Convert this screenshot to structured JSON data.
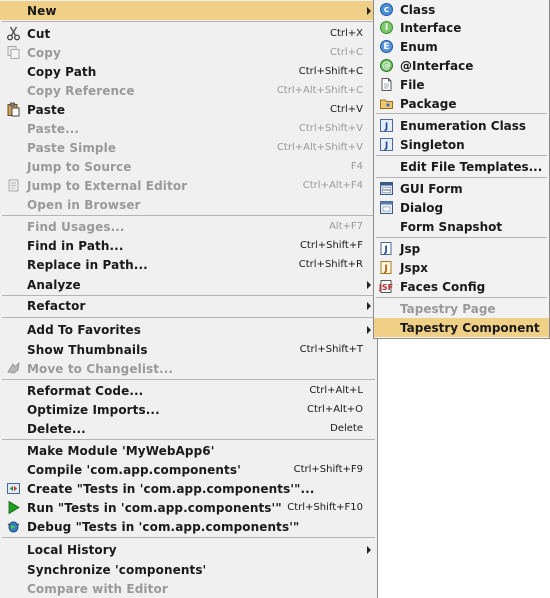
{
  "main_menu": {
    "items": [
      {
        "label": "New",
        "shortcut": "",
        "disabled": false,
        "submenu": true,
        "selected": true
      },
      {
        "label": "Cut",
        "shortcut": "Ctrl+X",
        "disabled": false,
        "icon": "scissors-icon"
      },
      {
        "label": "Copy",
        "shortcut": "Ctrl+C",
        "disabled": true,
        "icon": "copy-icon"
      },
      {
        "label": "Copy Path",
        "shortcut": "Ctrl+Shift+C",
        "disabled": false
      },
      {
        "label": "Copy Reference",
        "shortcut": "Ctrl+Alt+Shift+C",
        "disabled": true
      },
      {
        "label": "Paste",
        "shortcut": "Ctrl+V",
        "disabled": false,
        "icon": "paste-icon"
      },
      {
        "label": "Paste...",
        "shortcut": "Ctrl+Shift+V",
        "disabled": true
      },
      {
        "label": "Paste Simple",
        "shortcut": "Ctrl+Alt+Shift+V",
        "disabled": true
      },
      {
        "label": "Jump to Source",
        "shortcut": "F4",
        "disabled": true
      },
      {
        "label": "Jump to External Editor",
        "shortcut": "Ctrl+Alt+F4",
        "disabled": true,
        "icon": "external-editor-icon"
      },
      {
        "label": "Open in Browser",
        "shortcut": "",
        "disabled": true
      },
      {
        "label": "Find Usages...",
        "shortcut": "Alt+F7",
        "disabled": true
      },
      {
        "label": "Find in Path...",
        "shortcut": "Ctrl+Shift+F",
        "disabled": false
      },
      {
        "label": "Replace in Path...",
        "shortcut": "Ctrl+Shift+R",
        "disabled": false
      },
      {
        "label": "Analyze",
        "shortcut": "",
        "disabled": false,
        "submenu": true
      },
      {
        "label": "Refactor",
        "shortcut": "",
        "disabled": false,
        "submenu": true
      },
      {
        "label": "Add To Favorites",
        "shortcut": "",
        "disabled": false,
        "submenu": true
      },
      {
        "label": "Show Thumbnails",
        "shortcut": "Ctrl+Shift+T",
        "disabled": false
      },
      {
        "label": "Move to Changelist...",
        "shortcut": "",
        "disabled": true,
        "icon": "changelist-icon"
      },
      {
        "label": "Reformat Code...",
        "shortcut": "Ctrl+Alt+L",
        "disabled": false
      },
      {
        "label": "Optimize Imports...",
        "shortcut": "Ctrl+Alt+O",
        "disabled": false
      },
      {
        "label": "Delete...",
        "shortcut": "Delete",
        "disabled": false
      },
      {
        "label": "Make Module 'MyWebApp6'",
        "shortcut": "",
        "disabled": false
      },
      {
        "label": "Compile 'com.app.components'",
        "shortcut": "Ctrl+Shift+F9",
        "disabled": false
      },
      {
        "label": "Create  \"Tests in 'com.app.components'\"...",
        "shortcut": "",
        "disabled": false,
        "icon": "create-test-icon"
      },
      {
        "label": "Run \"Tests in 'com.app.components'\"",
        "shortcut": "Ctrl+Shift+F10",
        "disabled": false,
        "icon": "run-icon"
      },
      {
        "label": "Debug \"Tests in 'com.app.components'\"",
        "shortcut": "",
        "disabled": false,
        "icon": "debug-icon"
      },
      {
        "label": "Local History",
        "shortcut": "",
        "disabled": false,
        "submenu": true
      },
      {
        "label": "Synchronize 'components'",
        "shortcut": "",
        "disabled": false
      },
      {
        "label": "Compare with Editor",
        "shortcut": "",
        "disabled": true
      }
    ]
  },
  "sub_menu": {
    "items": [
      {
        "label": "Class",
        "icon": "class-icon",
        "disabled": false
      },
      {
        "label": "Interface",
        "icon": "interface-icon",
        "disabled": false
      },
      {
        "label": "Enum",
        "icon": "enum-icon",
        "disabled": false
      },
      {
        "label": "@Interface",
        "icon": "annotation-icon",
        "disabled": false
      },
      {
        "label": "File",
        "icon": "file-icon",
        "disabled": false
      },
      {
        "label": "Package",
        "icon": "package-icon",
        "disabled": false
      },
      {
        "label": "Enumeration Class",
        "icon": "enumeration-class-icon",
        "disabled": false
      },
      {
        "label": "Singleton",
        "icon": "singleton-icon",
        "disabled": false
      },
      {
        "label": "Edit File Templates...",
        "icon": "",
        "disabled": false
      },
      {
        "label": "GUI Form",
        "icon": "gui-form-icon",
        "disabled": false
      },
      {
        "label": "Dialog",
        "icon": "dialog-icon",
        "disabled": false
      },
      {
        "label": "Form Snapshot",
        "icon": "",
        "disabled": false
      },
      {
        "label": "Jsp",
        "icon": "jsp-icon",
        "disabled": false
      },
      {
        "label": "Jspx",
        "icon": "jspx-icon",
        "disabled": false
      },
      {
        "label": "Faces Config",
        "icon": "faces-config-icon",
        "disabled": false
      },
      {
        "label": "Tapestry Page",
        "icon": "",
        "disabled": true
      },
      {
        "label": "Tapestry Component",
        "icon": "",
        "disabled": false,
        "selected": true
      }
    ]
  },
  "colors": {
    "menu_bg": "#f0f0f0",
    "selection": "#f0cf86",
    "disabled_text": "#9a9a9a",
    "separator": "#b4b4b4"
  }
}
